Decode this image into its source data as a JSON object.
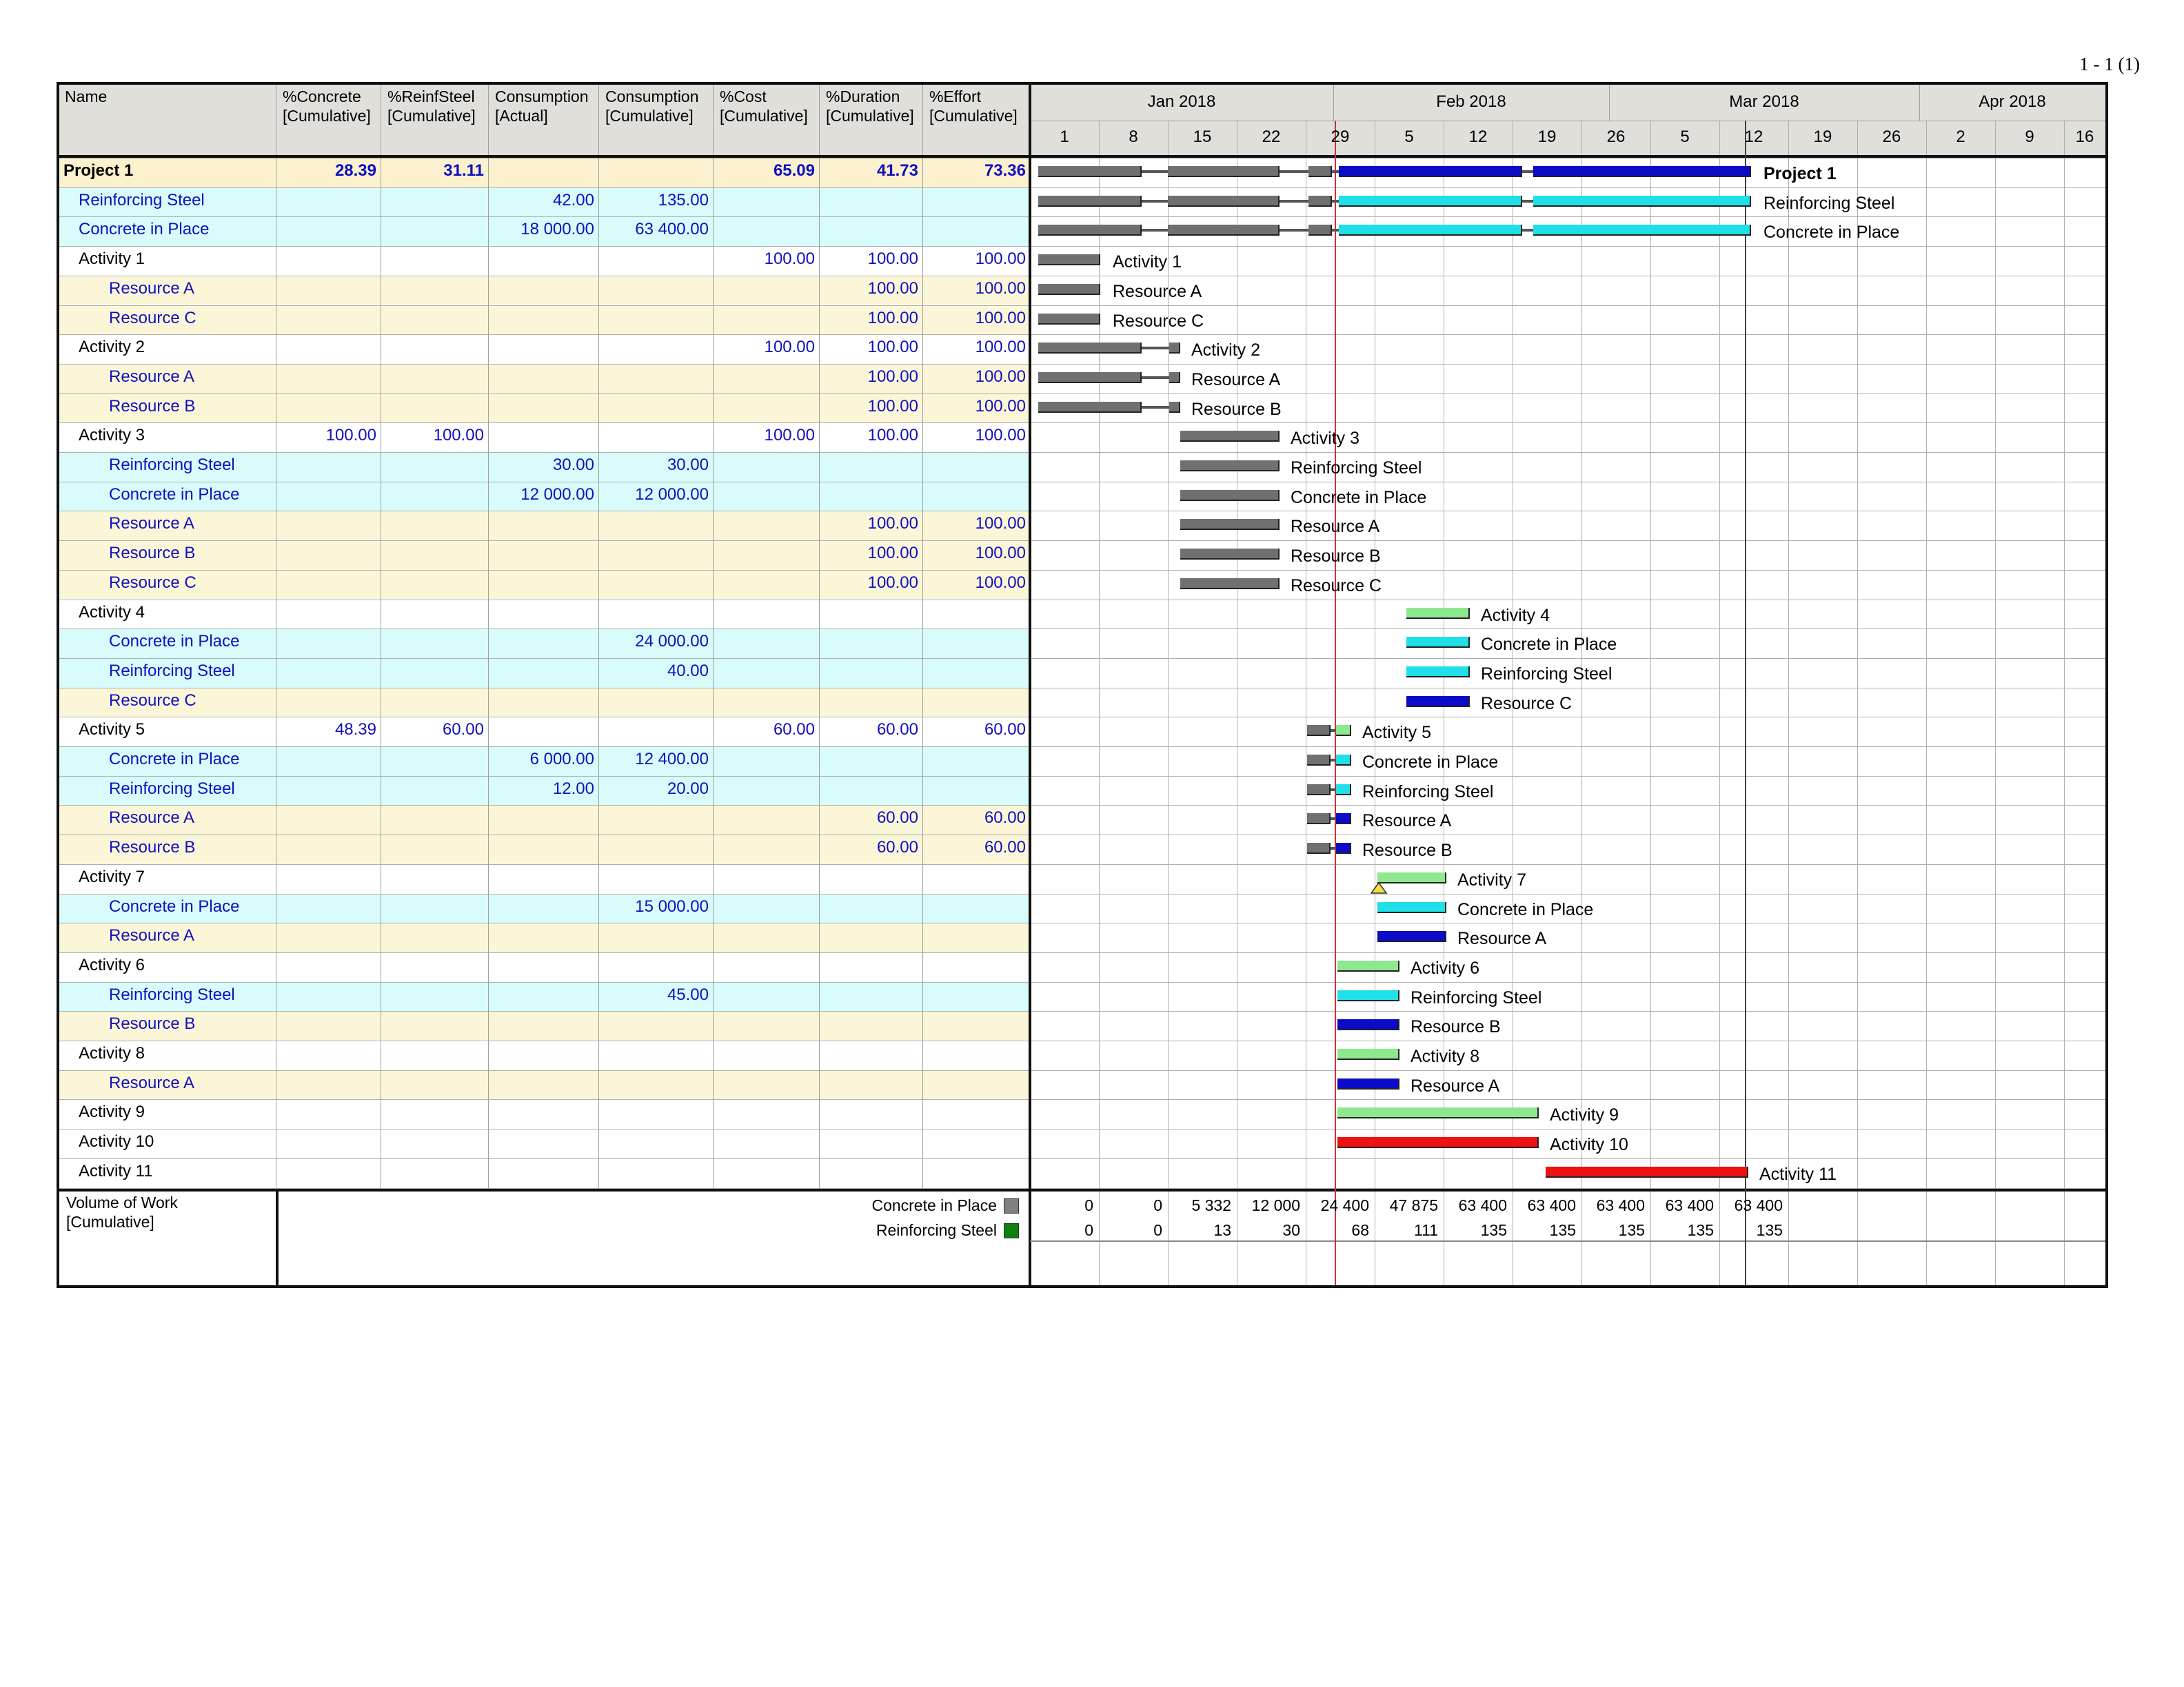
{
  "page_number": "1 - 1 (1)",
  "headers": [
    {
      "key": "name",
      "label": "Name"
    },
    {
      "key": "concrete",
      "label": "%Concrete\n[Cumulative]"
    },
    {
      "key": "steel",
      "label": "%ReinfSteel\n[Cumulative]"
    },
    {
      "key": "cons_act",
      "label": "Consumption\n[Actual]"
    },
    {
      "key": "cons_cum",
      "label": "Consumption\n[Cumulative]"
    },
    {
      "key": "cost",
      "label": "%Cost\n[Cumulative]"
    },
    {
      "key": "dur",
      "label": "%Duration\n[Cumulative]"
    },
    {
      "key": "eff",
      "label": "%Effort\n[Cumulative]"
    }
  ],
  "months": [
    "Jan 2018",
    "Feb 2018",
    "Mar 2018",
    "Apr 2018"
  ],
  "weeks": [
    "1",
    "8",
    "15",
    "22",
    "29",
    "5",
    "12",
    "19",
    "26",
    "5",
    "12",
    "19",
    "26",
    "2",
    "9",
    "16"
  ],
  "colors": {
    "project_bg": "#fbf1cf",
    "material_bg": "#d8fbfc",
    "resource_bg": "#fcf6d8",
    "grey_bar": "#707070",
    "blue_bar": "#0b0bc8",
    "cyan_bar": "#1fe0e8",
    "green_bar": "#8ee88e",
    "red_bar": "#ee1111"
  },
  "rows": [
    {
      "name": "Project 1",
      "type": "project",
      "indent": 0,
      "concrete": "28.39",
      "steel": "31.11",
      "cons_act": "",
      "cons_cum": "",
      "cost": "65.09",
      "dur": "41.73",
      "eff": "73.36",
      "label": "Project 1"
    },
    {
      "name": "Reinforcing Steel",
      "type": "material",
      "indent": 1,
      "concrete": "",
      "steel": "",
      "cons_act": "42.00",
      "cons_cum": "135.00",
      "cost": "",
      "dur": "",
      "eff": "",
      "label": "Reinforcing Steel"
    },
    {
      "name": "Concrete in Place",
      "type": "material",
      "indent": 1,
      "concrete": "",
      "steel": "",
      "cons_act": "18 000.00",
      "cons_cum": "63 400.00",
      "cost": "",
      "dur": "",
      "eff": "",
      "label": "Concrete in Place"
    },
    {
      "name": "Activity 1",
      "type": "activity",
      "indent": 1,
      "concrete": "",
      "steel": "",
      "cons_act": "",
      "cons_cum": "",
      "cost": "100.00",
      "dur": "100.00",
      "eff": "100.00",
      "label": "Activity 1"
    },
    {
      "name": "Resource A",
      "type": "resource",
      "indent": 2,
      "concrete": "",
      "steel": "",
      "cons_act": "",
      "cons_cum": "",
      "cost": "",
      "dur": "100.00",
      "eff": "100.00",
      "label": "Resource A"
    },
    {
      "name": "Resource C",
      "type": "resource",
      "indent": 2,
      "concrete": "",
      "steel": "",
      "cons_act": "",
      "cons_cum": "",
      "cost": "",
      "dur": "100.00",
      "eff": "100.00",
      "label": "Resource C"
    },
    {
      "name": "Activity 2",
      "type": "activity",
      "indent": 1,
      "concrete": "",
      "steel": "",
      "cons_act": "",
      "cons_cum": "",
      "cost": "100.00",
      "dur": "100.00",
      "eff": "100.00",
      "label": "Activity 2"
    },
    {
      "name": "Resource A",
      "type": "resource",
      "indent": 2,
      "concrete": "",
      "steel": "",
      "cons_act": "",
      "cons_cum": "",
      "cost": "",
      "dur": "100.00",
      "eff": "100.00",
      "label": "Resource A"
    },
    {
      "name": "Resource B",
      "type": "resource",
      "indent": 2,
      "concrete": "",
      "steel": "",
      "cons_act": "",
      "cons_cum": "",
      "cost": "",
      "dur": "100.00",
      "eff": "100.00",
      "label": "Resource B"
    },
    {
      "name": "Activity 3",
      "type": "activity",
      "indent": 1,
      "concrete": "100.00",
      "steel": "100.00",
      "cons_act": "",
      "cons_cum": "",
      "cost": "100.00",
      "dur": "100.00",
      "eff": "100.00",
      "label": "Activity 3"
    },
    {
      "name": "Reinforcing Steel",
      "type": "material",
      "indent": 2,
      "concrete": "",
      "steel": "",
      "cons_act": "30.00",
      "cons_cum": "30.00",
      "cost": "",
      "dur": "",
      "eff": "",
      "label": "Reinforcing Steel"
    },
    {
      "name": "Concrete in Place",
      "type": "material",
      "indent": 2,
      "concrete": "",
      "steel": "",
      "cons_act": "12 000.00",
      "cons_cum": "12 000.00",
      "cost": "",
      "dur": "",
      "eff": "",
      "label": "Concrete in Place"
    },
    {
      "name": "Resource A",
      "type": "resource",
      "indent": 2,
      "concrete": "",
      "steel": "",
      "cons_act": "",
      "cons_cum": "",
      "cost": "",
      "dur": "100.00",
      "eff": "100.00",
      "label": "Resource A"
    },
    {
      "name": "Resource B",
      "type": "resource",
      "indent": 2,
      "concrete": "",
      "steel": "",
      "cons_act": "",
      "cons_cum": "",
      "cost": "",
      "dur": "100.00",
      "eff": "100.00",
      "label": "Resource B"
    },
    {
      "name": "Resource C",
      "type": "resource",
      "indent": 2,
      "concrete": "",
      "steel": "",
      "cons_act": "",
      "cons_cum": "",
      "cost": "",
      "dur": "100.00",
      "eff": "100.00",
      "label": "Resource C"
    },
    {
      "name": "Activity 4",
      "type": "activity",
      "indent": 1,
      "concrete": "",
      "steel": "",
      "cons_act": "",
      "cons_cum": "",
      "cost": "",
      "dur": "",
      "eff": "",
      "label": "Activity 4"
    },
    {
      "name": "Concrete in Place",
      "type": "material",
      "indent": 2,
      "concrete": "",
      "steel": "",
      "cons_act": "",
      "cons_cum": "24 000.00",
      "cost": "",
      "dur": "",
      "eff": "",
      "label": "Concrete in Place"
    },
    {
      "name": "Reinforcing Steel",
      "type": "material",
      "indent": 2,
      "concrete": "",
      "steel": "",
      "cons_act": "",
      "cons_cum": "40.00",
      "cost": "",
      "dur": "",
      "eff": "",
      "label": "Reinforcing Steel"
    },
    {
      "name": "Resource C",
      "type": "resource",
      "indent": 2,
      "concrete": "",
      "steel": "",
      "cons_act": "",
      "cons_cum": "",
      "cost": "",
      "dur": "",
      "eff": "",
      "label": "Resource C"
    },
    {
      "name": "Activity 5",
      "type": "activity",
      "indent": 1,
      "concrete": "48.39",
      "steel": "60.00",
      "cons_act": "",
      "cons_cum": "",
      "cost": "60.00",
      "dur": "60.00",
      "eff": "60.00",
      "label": "Activity 5"
    },
    {
      "name": "Concrete in Place",
      "type": "material",
      "indent": 2,
      "concrete": "",
      "steel": "",
      "cons_act": "6 000.00",
      "cons_cum": "12 400.00",
      "cost": "",
      "dur": "",
      "eff": "",
      "label": "Concrete in Place"
    },
    {
      "name": "Reinforcing Steel",
      "type": "material",
      "indent": 2,
      "concrete": "",
      "steel": "",
      "cons_act": "12.00",
      "cons_cum": "20.00",
      "cost": "",
      "dur": "",
      "eff": "",
      "label": "Reinforcing Steel"
    },
    {
      "name": "Resource A",
      "type": "resource",
      "indent": 2,
      "concrete": "",
      "steel": "",
      "cons_act": "",
      "cons_cum": "",
      "cost": "",
      "dur": "60.00",
      "eff": "60.00",
      "label": "Resource A"
    },
    {
      "name": "Resource B",
      "type": "resource",
      "indent": 2,
      "concrete": "",
      "steel": "",
      "cons_act": "",
      "cons_cum": "",
      "cost": "",
      "dur": "60.00",
      "eff": "60.00",
      "label": "Resource B"
    },
    {
      "name": "Activity 7",
      "type": "activity",
      "indent": 1,
      "concrete": "",
      "steel": "",
      "cons_act": "",
      "cons_cum": "",
      "cost": "",
      "dur": "",
      "eff": "",
      "label": "Activity 7"
    },
    {
      "name": "Concrete in Place",
      "type": "material",
      "indent": 2,
      "concrete": "",
      "steel": "",
      "cons_act": "",
      "cons_cum": "15 000.00",
      "cost": "",
      "dur": "",
      "eff": "",
      "label": "Concrete in Place"
    },
    {
      "name": "Resource A",
      "type": "resource",
      "indent": 2,
      "concrete": "",
      "steel": "",
      "cons_act": "",
      "cons_cum": "",
      "cost": "",
      "dur": "",
      "eff": "",
      "label": "Resource A"
    },
    {
      "name": "Activity 6",
      "type": "activity",
      "indent": 1,
      "concrete": "",
      "steel": "",
      "cons_act": "",
      "cons_cum": "",
      "cost": "",
      "dur": "",
      "eff": "",
      "label": "Activity 6"
    },
    {
      "name": "Reinforcing Steel",
      "type": "material",
      "indent": 2,
      "concrete": "",
      "steel": "",
      "cons_act": "",
      "cons_cum": "45.00",
      "cost": "",
      "dur": "",
      "eff": "",
      "label": "Reinforcing Steel"
    },
    {
      "name": "Resource B",
      "type": "resource",
      "indent": 2,
      "concrete": "",
      "steel": "",
      "cons_act": "",
      "cons_cum": "",
      "cost": "",
      "dur": "",
      "eff": "",
      "label": "Resource B"
    },
    {
      "name": "Activity 8",
      "type": "activity",
      "indent": 1,
      "concrete": "",
      "steel": "",
      "cons_act": "",
      "cons_cum": "",
      "cost": "",
      "dur": "",
      "eff": "",
      "label": "Activity 8"
    },
    {
      "name": "Resource A",
      "type": "resource",
      "indent": 2,
      "concrete": "",
      "steel": "",
      "cons_act": "",
      "cons_cum": "",
      "cost": "",
      "dur": "",
      "eff": "",
      "label": "Resource A"
    },
    {
      "name": "Activity 9",
      "type": "activity",
      "indent": 1,
      "concrete": "",
      "steel": "",
      "cons_act": "",
      "cons_cum": "",
      "cost": "",
      "dur": "",
      "eff": "",
      "label": "Activity 9"
    },
    {
      "name": "Activity 10",
      "type": "activity",
      "indent": 1,
      "concrete": "",
      "steel": "",
      "cons_act": "",
      "cons_cum": "",
      "cost": "",
      "dur": "",
      "eff": "",
      "label": "Activity 10"
    },
    {
      "name": "Activity 11",
      "type": "activity",
      "indent": 1,
      "concrete": "",
      "steel": "",
      "cons_act": "",
      "cons_cum": "",
      "cost": "",
      "dur": "",
      "eff": "",
      "label": "Activity 11"
    }
  ],
  "volume": {
    "label": "Volume of Work\n[Cumulative]",
    "series": [
      {
        "name": "Concrete in Place",
        "color": "#808080",
        "values": [
          "0",
          "0",
          "5 332",
          "12 000",
          "24 400",
          "47 875",
          "63 400",
          "63 400",
          "63 400",
          "63 400",
          "63 400"
        ]
      },
      {
        "name": "Reinforcing Steel",
        "color": "#108010",
        "values": [
          "0",
          "0",
          "13",
          "30",
          "68",
          "111",
          "135",
          "135",
          "135",
          "135",
          "135"
        ]
      }
    ]
  }
}
